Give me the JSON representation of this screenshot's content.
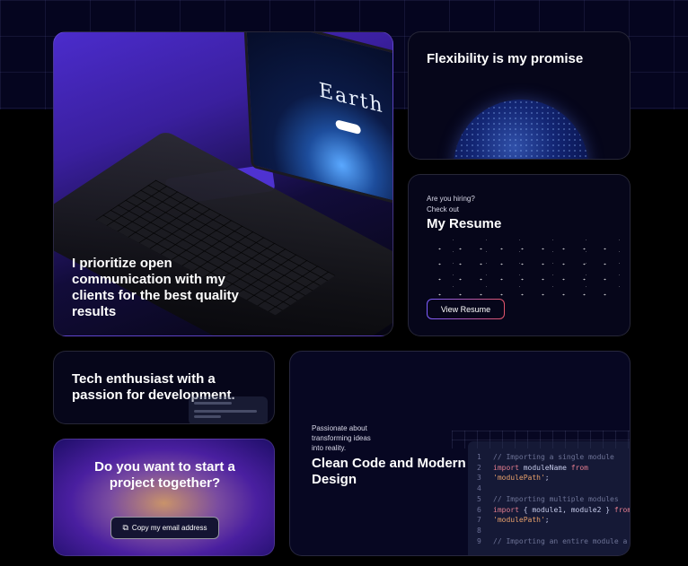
{
  "hero": {
    "text": "I prioritize open communication with my clients for the best quality results",
    "laptop": {
      "title": "Earth"
    }
  },
  "flexibility": {
    "title": "Flexibility is my promise"
  },
  "resume": {
    "line1": "Are you hiring?",
    "line2": "Check out",
    "title": "My Resume",
    "button": "View Resume"
  },
  "tech": {
    "title": "Tech enthusiast with a passion for development."
  },
  "project": {
    "title": "Do you want to start a project together?",
    "button": "Copy my email address",
    "button_icon": "copy-icon"
  },
  "code": {
    "line1": "Passionate about",
    "line2": "transforming ideas",
    "line3": "into reality.",
    "title": "Clean Code and Modern Design",
    "snippet": [
      {
        "num": "1",
        "parts": [
          {
            "cls": "cm",
            "text": "// Importing a single module"
          }
        ]
      },
      {
        "num": "2",
        "parts": [
          {
            "cls": "kw",
            "text": "import"
          },
          {
            "cls": "id",
            "text": " moduleName "
          },
          {
            "cls": "kw",
            "text": "from"
          }
        ]
      },
      {
        "num": "3",
        "parts": [
          {
            "cls": "st",
            "text": "'modulePath'"
          },
          {
            "cls": "id",
            "text": ";"
          }
        ]
      },
      {
        "num": "4",
        "parts": [
          {
            "cls": "id",
            "text": ""
          }
        ]
      },
      {
        "num": "5",
        "parts": [
          {
            "cls": "cm",
            "text": "// Importing multiple modules"
          }
        ]
      },
      {
        "num": "6",
        "parts": [
          {
            "cls": "kw",
            "text": "import"
          },
          {
            "cls": "id",
            "text": " { module1, module2 } "
          },
          {
            "cls": "kw",
            "text": "from"
          }
        ]
      },
      {
        "num": "7",
        "parts": [
          {
            "cls": "st",
            "text": "'modulePath'"
          },
          {
            "cls": "id",
            "text": ";"
          }
        ]
      },
      {
        "num": "8",
        "parts": [
          {
            "cls": "id",
            "text": ""
          }
        ]
      },
      {
        "num": "9",
        "parts": [
          {
            "cls": "cm",
            "text": "// Importing an entire module a"
          }
        ]
      }
    ]
  },
  "colors": {
    "background": "#000000",
    "card": "#06061a",
    "accent_purple": "#4b2ccc",
    "button_gradient_start": "#7b5cff",
    "button_gradient_end": "#e0556a"
  }
}
